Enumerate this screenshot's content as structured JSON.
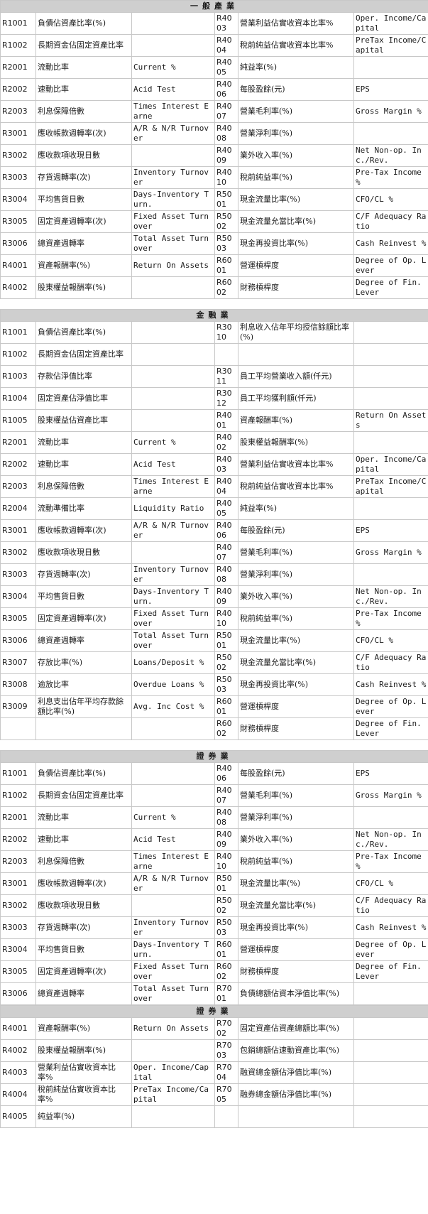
{
  "sections": [
    {
      "title": "一般產業",
      "rows": [
        [
          "R1001",
          "負債佔資產比率(%)",
          "",
          "R4003",
          "營業利益佔實收資本比率%",
          "Oper. Income/Capital"
        ],
        [
          "R1002",
          "長期資金佔固定資產比率",
          "",
          "R4004",
          "稅前純益佔實收資本比率%",
          "PreTax Income/Capital"
        ],
        [
          "R2001",
          "流動比率",
          "Current %",
          "R4005",
          "純益率(%)",
          ""
        ],
        [
          "R2002",
          "速動比率",
          "Acid Test",
          "R4006",
          "每股盈餘(元)",
          "EPS"
        ],
        [
          "R2003",
          "利息保障倍數",
          "Times Interest Earne",
          "R4007",
          "營業毛利率(%)",
          "Gross Margin %"
        ],
        [
          "R3001",
          "應收帳款週轉率(次)",
          "A/R & N/R Turnover",
          "R4008",
          "營業淨利率(%)",
          ""
        ],
        [
          "R3002",
          "應收款項收現日數",
          "",
          "R4009",
          "業外收入率(%)",
          "Net Non-op. Inc./Rev."
        ],
        [
          "R3003",
          "存貨週轉率(次)",
          "Inventory Turnover",
          "R4010",
          "稅前純益率(%)",
          "Pre-Tax Income %"
        ],
        [
          "R3004",
          "平均售貨日數",
          "Days-Inventory Turn.",
          "R5001",
          "現金流量比率(%)",
          "CFO/CL %"
        ],
        [
          "R3005",
          "固定資產週轉率(次)",
          "Fixed Asset Turnover",
          "R5002",
          "現金流量允當比率(%)",
          "C/F Adequacy Ratio"
        ],
        [
          "R3006",
          "總資產週轉率",
          "Total Asset Turnover",
          "R5003",
          "現金再投資比率(%)",
          "Cash Reinvest %"
        ],
        [
          "R4001",
          "資產報酬率(%)",
          "Return On Assets",
          "R6001",
          "營運槓桿度",
          "Degree of Op. Lever"
        ],
        [
          "R4002",
          "股東權益報酬率(%)",
          "",
          "R6002",
          "財務槓桿度",
          "Degree of Fin. Lever"
        ]
      ]
    },
    {
      "title": "金融業",
      "rows": [
        [
          "R1001",
          "負債佔資產比率(%)",
          "",
          "R3010",
          "利息收入佔年平均授信餘額比率(%)",
          ""
        ],
        [
          "R1002",
          "長期資金佔固定資產比率",
          "",
          "",
          "",
          ""
        ],
        [
          "R1003",
          "存款佔淨值比率",
          "",
          "R3011",
          "員工平均營業收入額(仟元)",
          ""
        ],
        [
          "R1004",
          "固定資產佔淨值比率",
          "",
          "R3012",
          "員工平均獲利額(仟元)",
          ""
        ],
        [
          "R1005",
          "股東權益佔資產比率",
          "",
          "R4001",
          "資產報酬率(%)",
          "Return On Assets"
        ],
        [
          "R2001",
          "流動比率",
          "Current %",
          "R4002",
          "股東權益報酬率(%)",
          ""
        ],
        [
          "R2002",
          "速動比率",
          "Acid Test",
          "R4003",
          "營業利益佔實收資本比率%",
          "Oper. Income/Capital"
        ],
        [
          "R2003",
          "利息保障倍數",
          "Times Interest Earne",
          "R4004",
          "稅前純益佔實收資本比率%",
          "PreTax Income/Capital"
        ],
        [
          "R2004",
          "流動準備比率",
          "Liquidity Ratio",
          "R4005",
          "純益率(%)",
          ""
        ],
        [
          "R3001",
          "應收帳款週轉率(次)",
          "A/R & N/R Turnover",
          "R4006",
          "每股盈餘(元)",
          "EPS"
        ],
        [
          "R3002",
          "應收款項收現日數",
          "",
          "R4007",
          "營業毛利率(%)",
          "Gross Margin %"
        ],
        [
          "R3003",
          "存貨週轉率(次)",
          "Inventory Turnover",
          "R4008",
          "營業淨利率(%)",
          ""
        ],
        [
          "R3004",
          "平均售貨日數",
          "Days-Inventory Turn.",
          "R4009",
          "業外收入率(%)",
          "Net Non-op. Inc./Rev."
        ],
        [
          "R3005",
          "固定資產週轉率(次)",
          "Fixed Asset Turnover",
          "R4010",
          "稅前純益率(%)",
          "Pre-Tax Income %"
        ],
        [
          "R3006",
          "總資產週轉率",
          "Total Asset Turnover",
          "R5001",
          "現金流量比率(%)",
          "CFO/CL %"
        ],
        [
          "R3007",
          "存放比率(%)",
          "Loans/Deposit %",
          "R5002",
          "現金流量允當比率(%)",
          "C/F Adequacy Ratio"
        ],
        [
          "R3008",
          "逾放比率",
          "Overdue Loans %",
          "R5003",
          "現金再投資比率(%)",
          "Cash Reinvest %"
        ],
        [
          "R3009",
          "利息支出佔年平均存款餘額比率(%)",
          "Avg. Inc Cost %",
          "R6001",
          "營運槓桿度",
          "Degree of Op. Lever"
        ],
        [
          "",
          "",
          "",
          "R6002",
          "財務槓桿度",
          "Degree of Fin. Lever"
        ]
      ]
    },
    {
      "title": "證券業",
      "rows": [
        [
          "R1001",
          "負債佔資產比率(%)",
          "",
          "R4006",
          "每股盈餘(元)",
          "EPS"
        ],
        [
          "R1002",
          "長期資金佔固定資產比率",
          "",
          "R4007",
          "營業毛利率(%)",
          "Gross Margin %"
        ],
        [
          "R2001",
          "流動比率",
          "Current %",
          "R4008",
          "營業淨利率(%)",
          ""
        ],
        [
          "R2002",
          "速動比率",
          "Acid Test",
          "R4009",
          "業外收入率(%)",
          "Net Non-op. Inc./Rev."
        ],
        [
          "R2003",
          "利息保障倍數",
          "Times Interest Earne",
          "R4010",
          "稅前純益率(%)",
          "Pre-Tax Income %"
        ],
        [
          "R3001",
          "應收帳款週轉率(次)",
          "A/R & N/R Turnover",
          "R5001",
          "現金流量比率(%)",
          "CFO/CL %"
        ],
        [
          "R3002",
          "應收款項收現日數",
          "",
          "R5002",
          "現金流量允當比率(%)",
          "C/F Adequacy Ratio"
        ],
        [
          "R3003",
          "存貨週轉率(次)",
          "Inventory Turnover",
          "R5003",
          "現金再投資比率(%)",
          "Cash Reinvest %"
        ],
        [
          "R3004",
          "平均售貨日數",
          "Days-Inventory Turn.",
          "R6001",
          "營運槓桿度",
          "Degree of Op. Lever"
        ],
        [
          "R3005",
          "固定資產週轉率(次)",
          "Fixed Asset Turnover",
          "R6002",
          "財務槓桿度",
          "Degree of Fin. Lever"
        ],
        [
          "R3006",
          "總資產週轉率",
          "Total Asset Turnover",
          "R7001",
          "負債總額佔資本淨值比率(%)",
          ""
        ]
      ]
    },
    {
      "title": "證券業",
      "rows": [
        [
          "R4001",
          "資產報酬率(%)",
          "Return On Assets",
          "R7002",
          "固定資產佔資產總額比率(%)",
          ""
        ],
        [
          "R4002",
          "股東權益報酬率(%)",
          "",
          "R7003",
          "包銷總額佔速動資產比率(%)",
          ""
        ],
        [
          "R4003",
          "營業利益佔實收資本比率%",
          "Oper. Income/Capital",
          "R7004",
          "融資總金額佔淨值比率(%)",
          ""
        ],
        [
          "R4004",
          "稅前純益佔實收資本比率%",
          "PreTax Income/Capital",
          "R7005",
          "融券總金額佔淨值比率(%)",
          ""
        ],
        [
          "R4005",
          "純益率(%)",
          "",
          "",
          "",
          ""
        ]
      ]
    }
  ]
}
